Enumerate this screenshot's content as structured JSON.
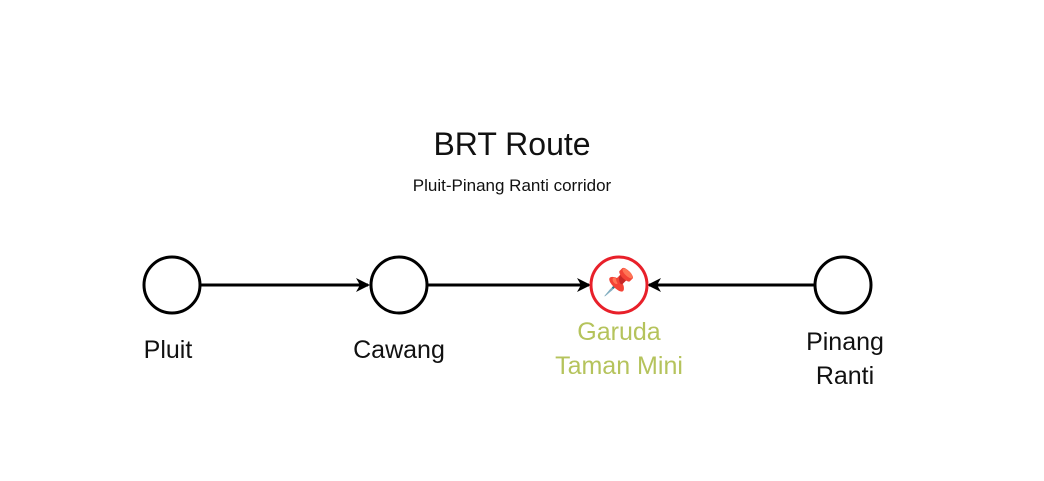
{
  "diagram": {
    "title": "BRT Route",
    "subtitle": "Pluit-Pinang Ranti corridor",
    "stations": [
      {
        "name": "Pluit",
        "lines": [
          "Pluit"
        ]
      },
      {
        "name": "Cawang",
        "lines": [
          "Cawang"
        ]
      },
      {
        "name": "Garuda Taman Mini",
        "lines": [
          "Garuda",
          "Taman Mini"
        ],
        "current": true,
        "marker": "📌"
      },
      {
        "name": "Pinang Ranti",
        "lines": [
          "Pinang",
          "Ranti"
        ]
      }
    ],
    "edges": [
      {
        "from": "Pluit",
        "to": "Cawang"
      },
      {
        "from": "Cawang",
        "to": "Garuda Taman Mini"
      },
      {
        "from": "Pinang Ranti",
        "to": "Garuda Taman Mini"
      }
    ],
    "colors": {
      "node_stroke": "#000000",
      "current_node_stroke": "#e8202a",
      "current_label": "#b5c35c",
      "edge": "#000000"
    },
    "icons": {
      "current_marker": "pushpin-icon"
    }
  }
}
